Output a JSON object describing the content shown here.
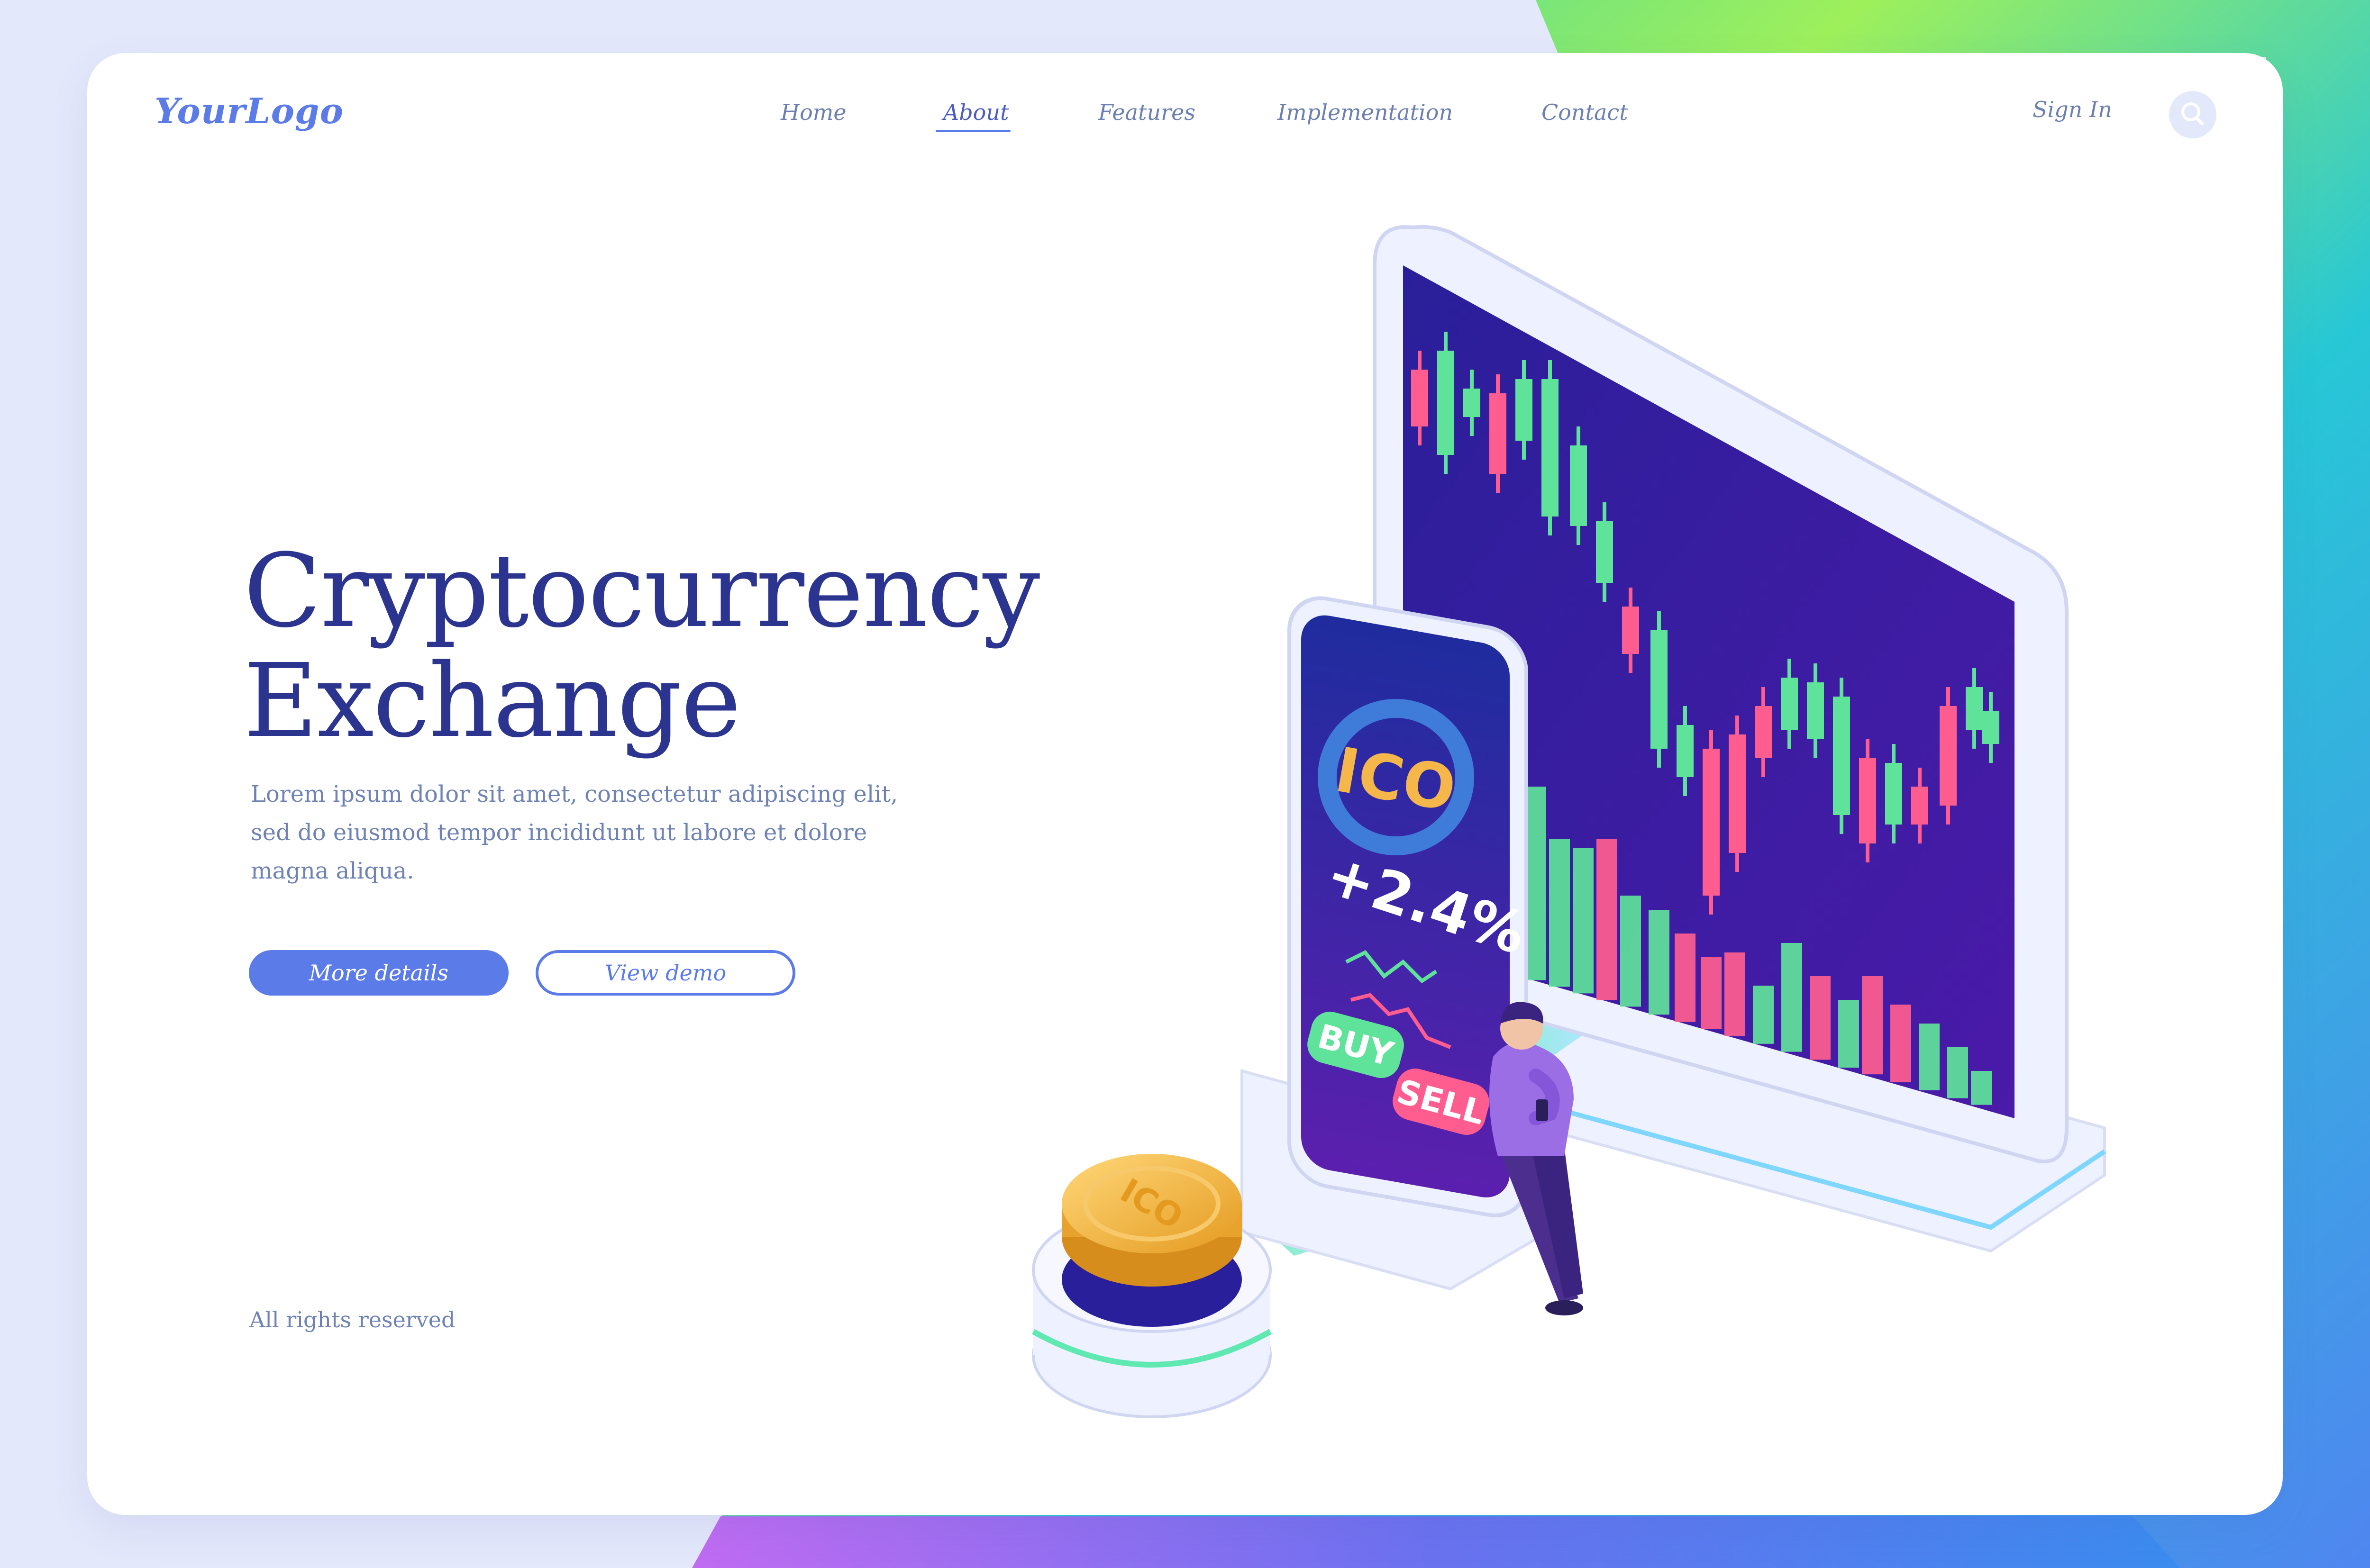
{
  "logo": "YourLogo",
  "nav": {
    "items": [
      {
        "label": "Home"
      },
      {
        "label": "About",
        "active": true
      },
      {
        "label": "Features"
      },
      {
        "label": "Implementation"
      },
      {
        "label": "Contact"
      }
    ],
    "sign_in": "Sign In",
    "search_icon": "search-icon"
  },
  "hero": {
    "title_line1": "Cryptocurrency",
    "title_line2": "Exchange",
    "description_lines": [
      "Lorem ipsum dolor sit amet, consectetur adipiscing elit,",
      "sed do eiusmod tempor incididunt ut labore et dolore",
      "magna aliqua."
    ],
    "primary_button": "More details",
    "secondary_button": "View demo"
  },
  "footer": {
    "copyright": "All rights reserved"
  },
  "illustration": {
    "phone": {
      "badge": "ICO",
      "change": "+2.4%",
      "buy": "BUY",
      "sell": "SELL"
    },
    "coin_label": "ICO"
  },
  "colors": {
    "accent": "#5b7be9",
    "title": "#2b3590",
    "text": "#6e82b4",
    "candle_up": "#5fe29a",
    "candle_down": "#ff5d8f",
    "screen": "#3b1ca8",
    "coin": "#f3b43b"
  }
}
